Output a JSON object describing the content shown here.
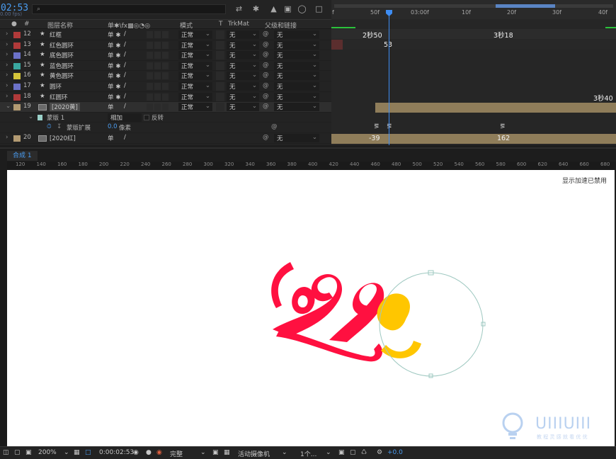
{
  "timeline": {
    "timecode": "02:53",
    "fps": "0.00 fps)",
    "search_icon": "⌕",
    "columns": {
      "label": "#",
      "layer_name": "图层名称",
      "switches": "单✱\\fx▩◎◔◎",
      "mode": "模式",
      "t": "T",
      "trkmat": "TrkMat",
      "parent": "父级和链接"
    },
    "layers": [
      {
        "num": "12",
        "name": "红框",
        "color": "#b03a3a",
        "mode": "正常",
        "trk": "无",
        "parent": "无"
      },
      {
        "num": "13",
        "name": "红色圆环",
        "color": "#b03a3a",
        "mode": "正常",
        "trk": "无",
        "parent": "无"
      },
      {
        "num": "14",
        "name": "底色圆环",
        "color": "#6c72c8",
        "mode": "正常",
        "trk": "无",
        "parent": "无"
      },
      {
        "num": "15",
        "name": "蓝色圆环",
        "color": "#3aa8a0",
        "mode": "正常",
        "trk": "无",
        "parent": "无"
      },
      {
        "num": "16",
        "name": "黄色圆环",
        "color": "#d4c43a",
        "mode": "正常",
        "trk": "无",
        "parent": "无"
      },
      {
        "num": "17",
        "name": "圆环",
        "color": "#6c72c8",
        "mode": "正常",
        "trk": "无",
        "parent": "无"
      },
      {
        "num": "18",
        "name": "红圆环",
        "color": "#b03a3a",
        "mode": "正常",
        "trk": "无",
        "parent": "无"
      },
      {
        "num": "19",
        "name": "[2020黄]",
        "color": "#b29a72",
        "mode": "正常",
        "trk": "无",
        "parent": "无"
      }
    ],
    "mask_row": {
      "name": "蒙版 1",
      "mode": "相加",
      "invert": "反转"
    },
    "feather_row": {
      "name": "蒙版扩展",
      "value": "0.0",
      "unit": "像素"
    },
    "layer20": {
      "num": "20",
      "name": "[2020红]",
      "color": "#b29a72",
      "parent": "无"
    },
    "ruler_ticks": [
      "f",
      "50f",
      "03:00f",
      "10f",
      "20f",
      "30f",
      "40f"
    ],
    "labels": {
      "row12_a": "2秒50",
      "row12_b": "3秒18",
      "row13": "53",
      "row18": "3秒40",
      "row20_a": "-39",
      "row20_b": "162"
    }
  },
  "composition": {
    "tab": "合成 1",
    "ruler_marks": [
      "120",
      "140",
      "160",
      "180",
      "200",
      "220",
      "240",
      "260",
      "280",
      "300",
      "320",
      "340",
      "360",
      "380",
      "400",
      "420",
      "440",
      "460",
      "480",
      "500",
      "520",
      "540",
      "560",
      "580",
      "600",
      "620",
      "640",
      "660",
      "680"
    ],
    "accel_notice": "显示加速已禁用",
    "logo_text": "2020",
    "watermark": "UIIIUIII",
    "watermark_sub": "教 程 灵 感 就 看 优 优"
  },
  "status_bar": {
    "zoom": "200%",
    "timecode": "0:00:02:53",
    "resolution": "完整",
    "camera": "活动摄像机",
    "views": "1个...",
    "exposure": "+0.0"
  }
}
